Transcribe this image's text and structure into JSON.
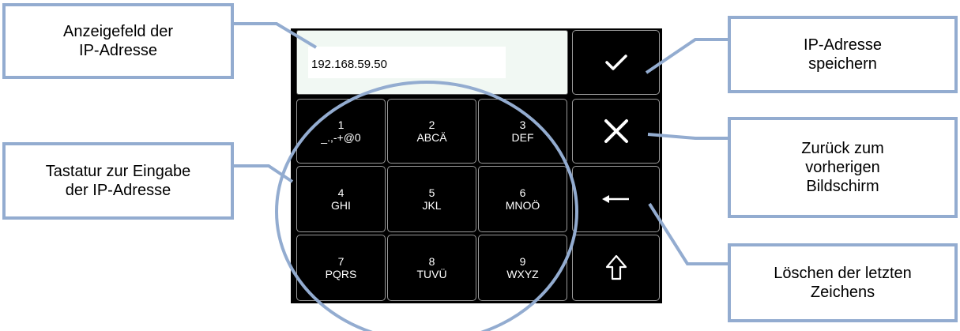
{
  "display": {
    "value": "192.168.59.50"
  },
  "keys": [
    {
      "num": "1",
      "letters": "_.,-+@0"
    },
    {
      "num": "2",
      "letters": "ABCÄ"
    },
    {
      "num": "3",
      "letters": "DEF"
    },
    {
      "num": "4",
      "letters": "GHI"
    },
    {
      "num": "5",
      "letters": "JKL"
    },
    {
      "num": "6",
      "letters": "MNOÖ"
    },
    {
      "num": "7",
      "letters": "PQRS"
    },
    {
      "num": "8",
      "letters": "TUVÜ"
    },
    {
      "num": "9",
      "letters": "WXYZ"
    }
  ],
  "side_buttons": {
    "confirm_icon": "checkmark-icon",
    "cancel_icon": "close-icon",
    "backspace_icon": "arrow-left-icon",
    "shift_icon": "shift-arrow-up-icon"
  },
  "callouts": {
    "display_field": "Anzeigefeld der\nIP-Adresse",
    "keypad": "Tastatur zur Eingabe\nder IP-Adresse",
    "save": "IP-Adresse\nspeichern",
    "back": "Zurück zum\nvorherigen\nBildschirm",
    "delete": "Löschen der letzten\nZeichens"
  },
  "colors": {
    "callout_border": "#93acd0",
    "device_bg": "#000000",
    "display_bg": "#f1f8f3"
  }
}
